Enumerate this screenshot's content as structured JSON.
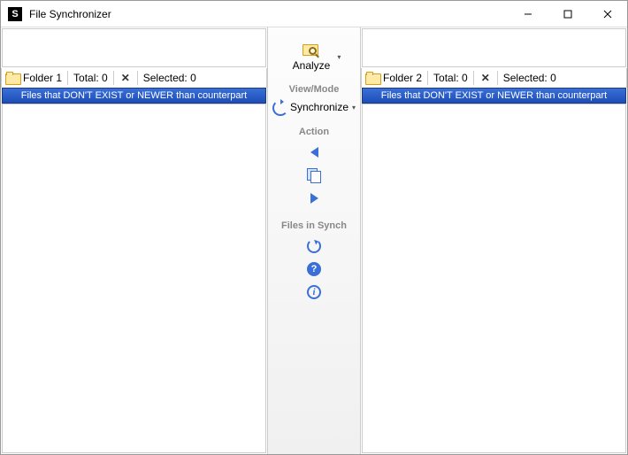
{
  "window": {
    "title": "File Synchronizer",
    "minimize": "–",
    "maximize": "▢",
    "close": "✕"
  },
  "left_pane": {
    "folder_label": "Folder 1",
    "total_label": "Total: 0",
    "selected_label": "Selected: 0",
    "blue_bar": "Files that DON'T EXIST or NEWER than counterpart"
  },
  "right_pane": {
    "folder_label": "Folder 2",
    "total_label": "Total: 0",
    "selected_label": "Selected: 0",
    "blue_bar": "Files that DON'T EXIST or NEWER than counterpart"
  },
  "center": {
    "analyze_label": "Analyze",
    "viewmode_header": "View/Mode",
    "synchronize_label": "Synchronize",
    "action_header": "Action",
    "files_in_synch_header": "Files in Synch",
    "help_glyph": "?",
    "info_glyph": "i"
  }
}
